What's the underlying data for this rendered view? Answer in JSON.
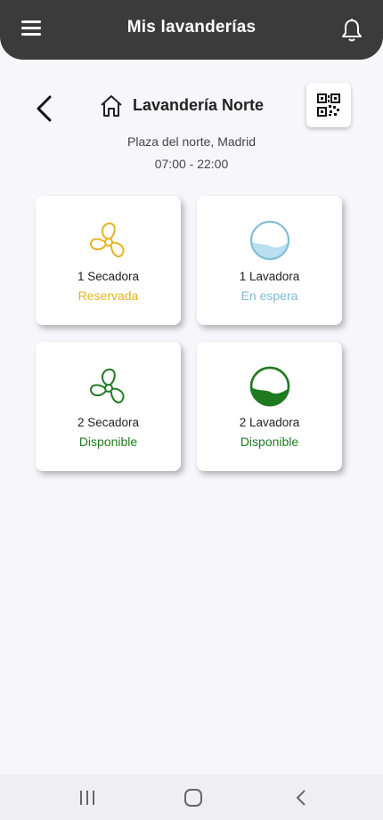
{
  "topbar": {
    "title": "Mis lavanderías"
  },
  "laundry": {
    "name": "Lavandería Norte",
    "address": "Plaza del norte, Madrid",
    "hours": "07:00 - 22:00"
  },
  "machines": [
    {
      "label": "1 Secadora",
      "status": "Reservada",
      "type": "dryer",
      "color": "#e8b21e"
    },
    {
      "label": "1 Lavadora",
      "status": "En espera",
      "type": "washer",
      "color": "#7dbcd6"
    },
    {
      "label": "2 Secadora",
      "status": "Disponible",
      "type": "dryer",
      "color": "#1f7a1f"
    },
    {
      "label": "2 Lavadora",
      "status": "Disponible",
      "type": "washer",
      "color": "#1f7a1f"
    }
  ],
  "icons": {
    "menu": "menu-icon",
    "bell": "bell-icon",
    "back": "back-arrow-icon",
    "home": "home-icon",
    "qr": "qr-code-icon",
    "dryer": "fan-icon",
    "washer": "washer-drum-icon"
  },
  "colors": {
    "topbar": "#3b3b3b",
    "background": "#f7f6fa"
  }
}
